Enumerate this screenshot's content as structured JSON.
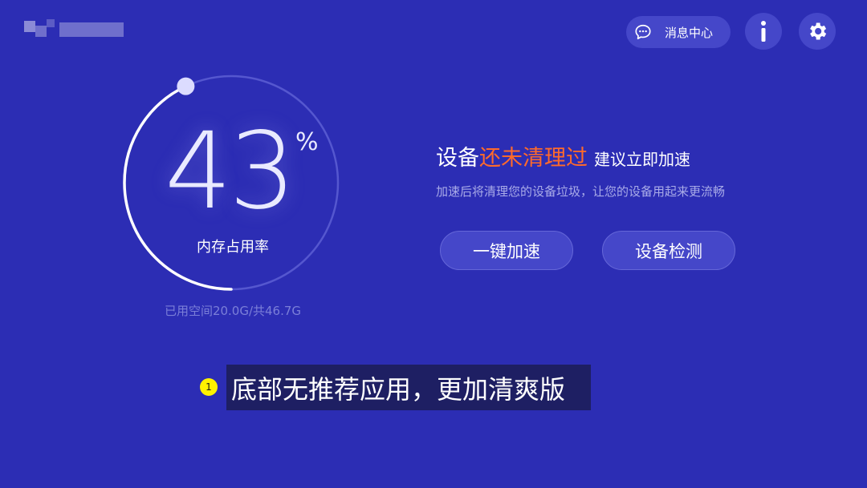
{
  "header": {
    "message_center_label": "消息中心"
  },
  "icons": {
    "message": "chat-bubble-icon",
    "info": "info-icon",
    "settings": "gear-icon"
  },
  "gauge": {
    "value": "43",
    "unit": "%",
    "percent": 43,
    "label": "内存占用率",
    "storage_text": "已用空间20.0G/共46.7G"
  },
  "status": {
    "prefix": "设备",
    "highlight": "还未清理过",
    "suffix": "建议立即加速",
    "description": "加速后将清理您的设备垃圾，让您的设备用起来更流畅"
  },
  "actions": {
    "speed_up": "一键加速",
    "device_check": "设备检测"
  },
  "caption": {
    "badge": "1",
    "text": "底部无推荐应用，更加清爽版"
  },
  "colors": {
    "background": "#2c2db4",
    "highlight": "#ff6a2b",
    "button": "#4547c9",
    "caption_bg": "#1e1f63",
    "badge": "#fff200"
  }
}
